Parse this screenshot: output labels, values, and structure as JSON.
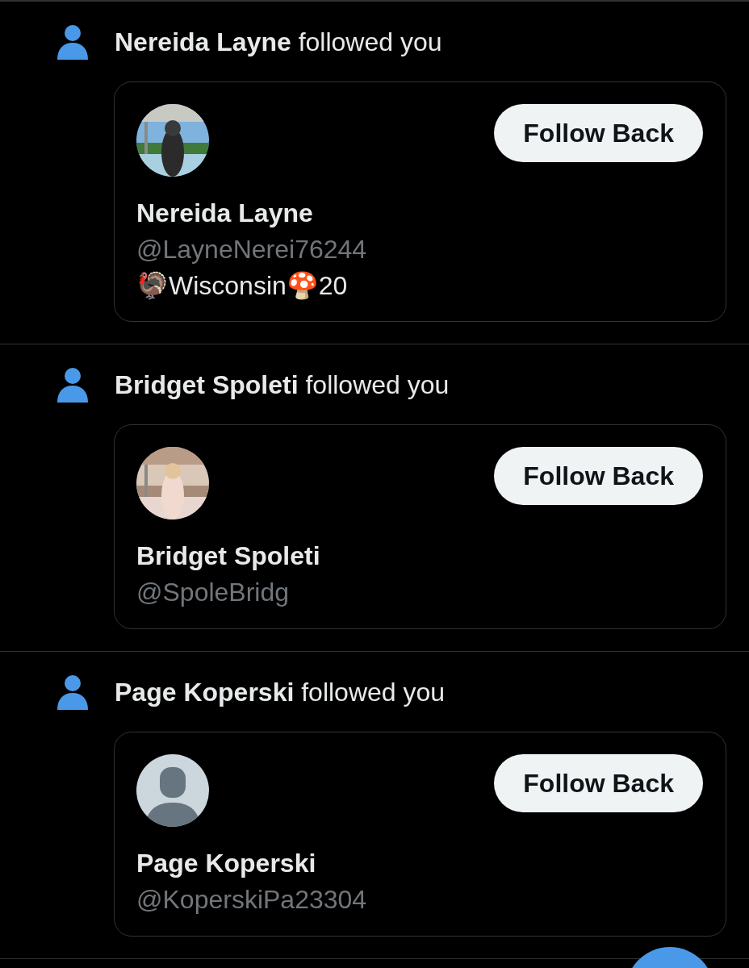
{
  "notifications": [
    {
      "headline": "**Nereida Layne** followed you",
      "button": "Follow Back",
      "name": "Nereida Layne",
      "handle": "@LayneNerei76244",
      "bio": "🦃Wisconsin🍄20"
    },
    {
      "headline": "**Bridget Spoleti** followed you",
      "button": "Follow Back",
      "name": "Bridget Spoleti",
      "handle": "@SpoleBridg"
    },
    {
      "headline": "**Page Koperski** followed you",
      "avatar": {
        "kind": "default"
      },
      "button": "Follow Back",
      "name": "Page Koperski",
      "handle": "@KoperskiPa23304"
    }
  ]
}
